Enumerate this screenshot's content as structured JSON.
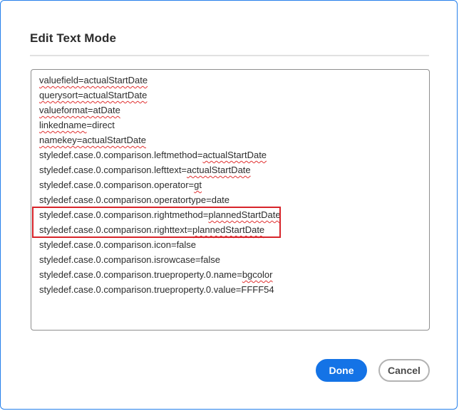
{
  "dialog": {
    "title": "Edit Text Mode"
  },
  "textarea": {
    "lines": [
      {
        "pre": "",
        "sq": "valuefield=actualStartDate",
        "post": ""
      },
      {
        "pre": "",
        "sq": "querysort=actualStartDate",
        "post": ""
      },
      {
        "pre": "",
        "sq": "valueformat=atDate",
        "post": ""
      },
      {
        "pre": "",
        "sq": "linkedname",
        "post": "=direct"
      },
      {
        "pre": "",
        "sq": "namekey=actualStartDate",
        "post": ""
      },
      {
        "pre": "styledef.case.0.comparison.leftmethod=",
        "sq": "actualStartDate",
        "post": ""
      },
      {
        "pre": "styledef.case.0.comparison.lefttext=",
        "sq": "actualStartDate",
        "post": ""
      },
      {
        "pre": "styledef.case.0.comparison.operator=",
        "sq": "gt",
        "post": ""
      },
      {
        "pre": "styledef.case.0.comparison.operatortype=date",
        "sq": "",
        "post": ""
      },
      {
        "pre": "styledef.case.0.comparison.rightmethod=",
        "sq": "plannedStartDate",
        "post": ""
      },
      {
        "pre": "styledef.case.0.comparison.righttext=",
        "sq": "plannedStartDate",
        "post": ""
      },
      {
        "pre": "styledef.case.0.comparison.icon=false",
        "sq": "",
        "post": ""
      },
      {
        "pre": "styledef.case.0.comparison.isrowcase=false",
        "sq": "",
        "post": ""
      },
      {
        "pre": "styledef.case.0.comparison.trueproperty.0.name=",
        "sq": "bgcolor",
        "post": ""
      },
      {
        "pre": "styledef.case.0.comparison.trueproperty.0.value=FFFF54",
        "sq": "",
        "post": ""
      }
    ]
  },
  "buttons": {
    "done_label": "Done",
    "cancel_label": "Cancel"
  },
  "colors": {
    "accent": "#1473e6",
    "highlight_border": "#d7242a",
    "spellcheck": "#e03131"
  }
}
